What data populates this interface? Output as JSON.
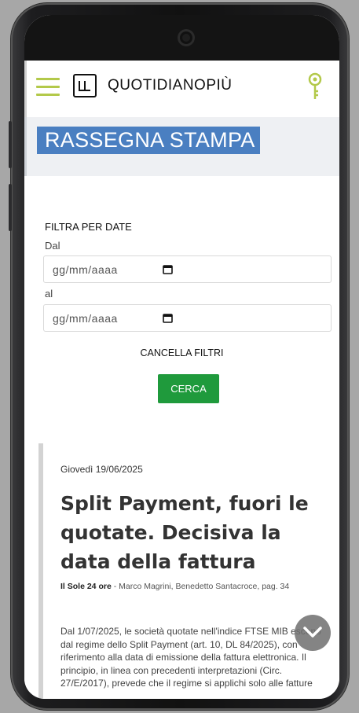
{
  "header": {
    "brand": "QUOTIDIANOPIÙ",
    "menu_icon": "hamburger-menu-icon",
    "logo_icon": "quotidianopiu-logo-icon",
    "login_icon": "key-icon"
  },
  "page": {
    "title": "RASSEGNA STAMPA"
  },
  "filter": {
    "title": "FILTRA PER DATE",
    "from_label": "Dal",
    "from_placeholder": "gg/mm/aaaa",
    "to_label": "al",
    "to_placeholder": "gg/mm/aaaa",
    "clear_label": "CANCELLA FILTRI",
    "search_label": "CERCA"
  },
  "article": {
    "date": "Giovedì 19/06/2025",
    "title": "Split Payment, fuori le quotate. Decisiva la data della fattura",
    "source_name": "Il Sole 24 ore",
    "source_details": " - Marco Magrini, Benedetto Santacroce, pag. 34",
    "body": "Dal 1/07/2025, le società quotate nell'indice FTSE MIB escono dal regime dello Split Payment (art. 10, DL 84/2025), con riferimento alla data di emissione della fattura elettronica. Il principio, in linea con precedenti interpretazioni (Circ. 27/E/2017), prevede che il regime si applichi solo alle fatture"
  },
  "colors": {
    "accent_green": "#b3c94a",
    "title_blue": "#4a7fc1",
    "button_green": "#1f9a3c"
  }
}
